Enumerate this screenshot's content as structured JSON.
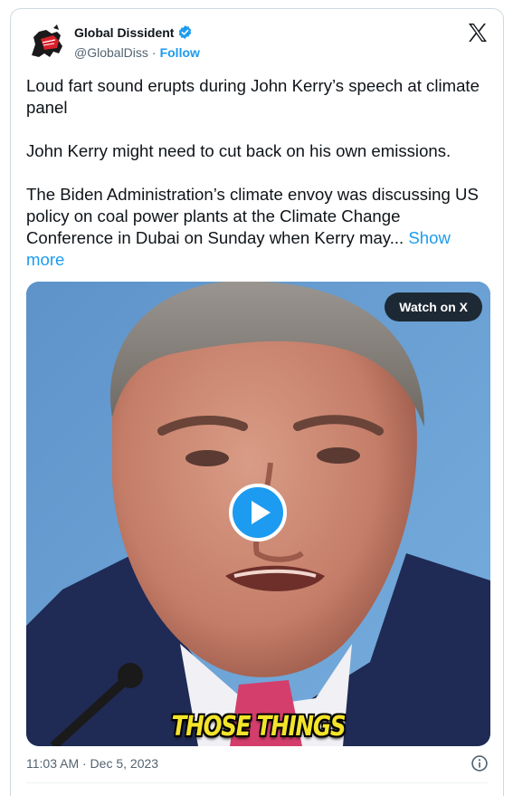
{
  "author": {
    "display_name": "Global Dissident",
    "handle": "@GlobalDiss",
    "separator": "·",
    "follow_label": "Follow",
    "verified_color": "#1d9bf0"
  },
  "tweet": {
    "paragraphs": [
      "Loud fart sound erupts during John Kerry’s speech at climate panel",
      "John Kerry might need to cut back on his own emissions.",
      "The Biden Administration’s climate envoy was discussing US policy on coal power plants at the Climate Change Conference in Dubai on Sunday when Kerry may..."
    ],
    "show_more_label": "Show more",
    "timestamp": "11:03 AM · Dec 5, 2023"
  },
  "media": {
    "watch_label": "Watch on X",
    "caption": "THOSE THINGS",
    "play_icon": "play-icon"
  },
  "icons": {
    "brand": "x-logo-icon",
    "info": "info-icon",
    "verified": "verified-badge-icon"
  },
  "colors": {
    "accent": "#1d9bf0",
    "text": "#0f1419",
    "muted": "#536471",
    "caption": "#f4e42a"
  }
}
